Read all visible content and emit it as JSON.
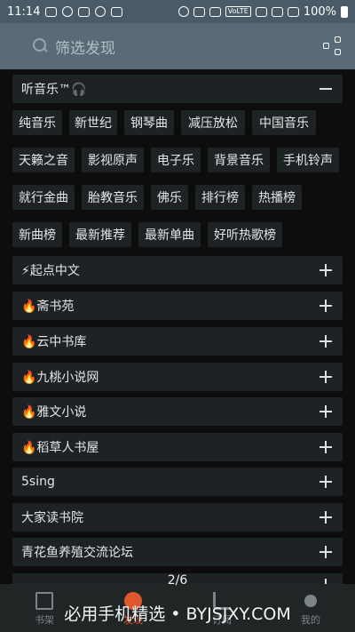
{
  "status": {
    "time": "11:14",
    "network_tag": "VoLTE",
    "battery": "100%"
  },
  "search": {
    "placeholder": "筛选发现"
  },
  "music_group": {
    "title": "听音乐™🎧",
    "expanded": true,
    "tags": [
      "纯音乐",
      "新世纪",
      "钢琴曲",
      "减压放松",
      "中国音乐",
      "天籁之音",
      "影视原声",
      "电子乐",
      "背景音乐",
      "手机铃声",
      "就行金曲",
      "胎教音乐",
      "佛乐",
      "排行榜",
      "热播榜",
      "新曲榜",
      "最新推荐",
      "最新单曲",
      "好听热歌榜"
    ]
  },
  "groups": [
    {
      "title": "⚡起点中文"
    },
    {
      "title": "🔥斋书苑"
    },
    {
      "title": "🔥云中书库"
    },
    {
      "title": "🔥九桃小说网"
    },
    {
      "title": "🔥雅文小说"
    },
    {
      "title": "🔥稻草人书屋"
    },
    {
      "title": "5sing"
    },
    {
      "title": "大家读书院"
    },
    {
      "title": "青花鱼养殖交流论坛"
    }
  ],
  "page_indicator": "2/6",
  "bottom_nav": [
    {
      "label": "书架"
    },
    {
      "label": "发现"
    },
    {
      "label": "订阅"
    },
    {
      "label": "我的"
    }
  ],
  "watermark": "必用手机精选 • BYJSJXY.COM",
  "colors": {
    "accent": "#e0572f",
    "toolbar": "#596b77",
    "tile": "#1d2224",
    "background": "#0d0d0d"
  }
}
